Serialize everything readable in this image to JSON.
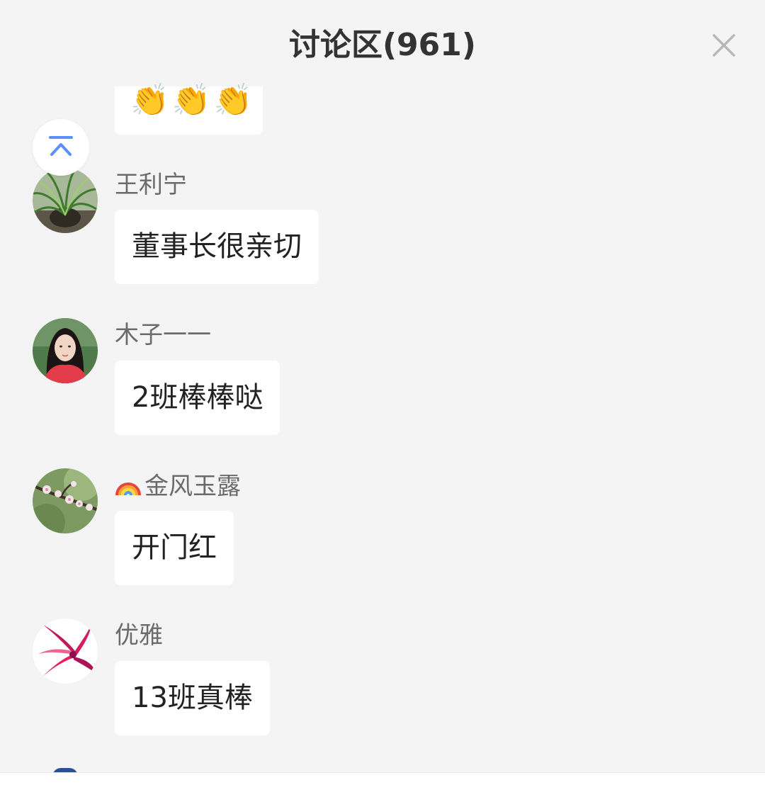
{
  "header": {
    "title": "讨论区(961)"
  },
  "partial_message": {
    "content": "👏👏👏"
  },
  "messages": [
    {
      "user": "王利宁",
      "content": "董事长很亲切"
    },
    {
      "user": "木子一一",
      "content": "2班棒棒哒"
    },
    {
      "user": "金风玉露",
      "content": "开门红"
    },
    {
      "user": "优雅",
      "content": "13班真棒"
    }
  ],
  "icons": {
    "close": "close-icon",
    "scroll_top": "arrow-to-top-icon",
    "rainbow": "rainbow-emoji-icon"
  },
  "colors": {
    "background": "#f4f4f4",
    "bubble": "#ffffff",
    "accent": "#5b8ff9",
    "name": "#6b6b6b"
  }
}
